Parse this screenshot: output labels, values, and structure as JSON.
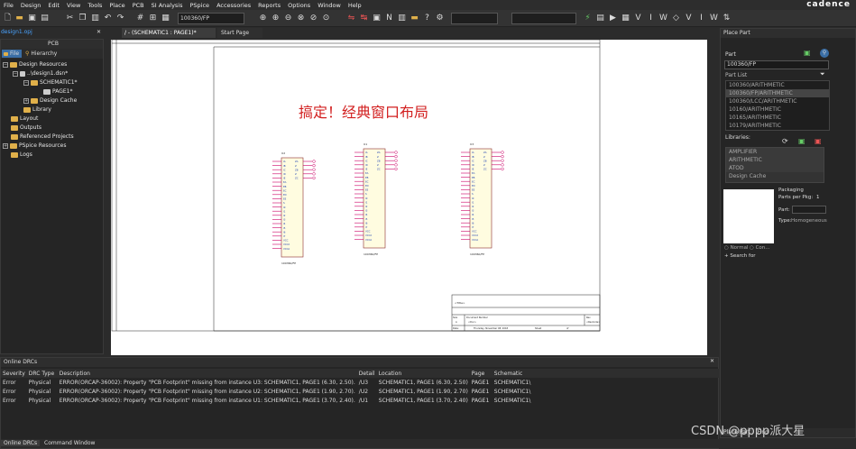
{
  "menu": [
    "File",
    "Design",
    "Edit",
    "View",
    "Tools",
    "Place",
    "PCB",
    "SI Analysis",
    "PSpice",
    "Accessories",
    "Reports",
    "Options",
    "Window",
    "Help"
  ],
  "brand": "cadence",
  "toolbar": {
    "part_combo": "100360/FP"
  },
  "tabs": {
    "project": "design1.opj",
    "active_doc": "/ - (SCHEMATIC1 : PAGE1)*",
    "start_page": "Start Page"
  },
  "left_panel": {
    "title": "PCB",
    "tab_file": "File",
    "tab_hier": "Hierarchy",
    "tree": [
      "Design Resources",
      "..\\design1.dsn*",
      "SCHEMATIC1*",
      "PAGE1*",
      "Design Cache",
      "Library",
      "Layout",
      "Outputs",
      "Referenced Projects",
      "PSpice Resources",
      "Logs"
    ]
  },
  "schematic": {
    "title_text": "搞定！经典窗口布局",
    "parts": [
      {
        "ref": "U2",
        "value": "100360/FP"
      },
      {
        "ref": "U1",
        "value": "100360/FP"
      },
      {
        "ref": "U3",
        "value": "100360/FP"
      }
    ],
    "pins_left": [
      "IA",
      "IB",
      "IC",
      "ID",
      "IE",
      "EA",
      "EB",
      "EC",
      "ED",
      "EE",
      "S",
      "I0",
      "I1",
      "I2",
      "I3",
      "I4",
      "I5",
      "I6",
      "I7",
      "VCC",
      "VCC2",
      "VCCA"
    ],
    "pins_right": [
      "ZA",
      "Z",
      "ZB",
      "Z",
      "ZC"
    ],
    "titleblock": {
      "title": "<Title>",
      "size": "Size",
      "size_val": "A",
      "docnum": "Document Number",
      "docnum_val": "<Doc>",
      "rev": "Rev",
      "rev_val": "<RevCode>",
      "date": "Date:",
      "date_val": "Thursday, November 08, 2018",
      "sheet": "Sheet",
      "sheet_of": "of"
    }
  },
  "right_panel": {
    "title": "Place Part",
    "part_label": "Part",
    "part_value": "100360/FP",
    "part_list_label": "Part List",
    "parts": [
      "100360/ARITHMETIC",
      "100360/FP/ARITHMETIC",
      "100360/LCC/ARITHMETIC",
      "10160/ARITHMETIC",
      "10165/ARITHMETIC",
      "10179/ARITHMETIC"
    ],
    "libraries_label": "Libraries:",
    "libraries": [
      "AMPLIFIER",
      "ARITHMETIC",
      "ATOD",
      "Design Cache"
    ],
    "packaging": "Packaging",
    "parts_per_pkg": "Parts per Pkg:",
    "parts_per_pkg_val": "1",
    "part_label2": "Part:",
    "type_label": "Type:",
    "type_val": "Homogeneous",
    "normal": "Normal",
    "convert": "Con...",
    "search": "Search for",
    "bottom_tabs": [
      "Place Part",
      "Find"
    ]
  },
  "drc": {
    "title": "Online DRCs",
    "columns": [
      "Severity",
      "DRC Type",
      "Description",
      "Detail",
      "Location",
      "Page",
      "Schematic"
    ],
    "rows": [
      [
        "Error",
        "Physical",
        "ERROR(ORCAP-36002): Property \"PCB Footprint\" missing from instance U3: SCHEMATIC1, PAGE1 (6.30, 2.50).",
        "/U3",
        "SCHEMATIC1, PAGE1  (6.30, 2.50)",
        "PAGE1",
        "SCHEMATIC1\\"
      ],
      [
        "Error",
        "Physical",
        "ERROR(ORCAP-36002): Property \"PCB Footprint\" missing from instance U2: SCHEMATIC1, PAGE1 (1.90, 2.70).",
        "/U2",
        "SCHEMATIC1, PAGE1  (1.90, 2.70)",
        "PAGE1",
        "SCHEMATIC1\\"
      ],
      [
        "Error",
        "Physical",
        "ERROR(ORCAP-36002): Property \"PCB Footprint\" missing from instance U1: SCHEMATIC1, PAGE1 (3.70, 2.40).",
        "/U1",
        "SCHEMATIC1, PAGE1  (3.70, 2.40)",
        "PAGE1",
        "SCHEMATIC1\\"
      ]
    ],
    "bottom_tabs": [
      "Online DRCs",
      "Command Window"
    ]
  },
  "watermark": "CSDN @pppp派大星"
}
